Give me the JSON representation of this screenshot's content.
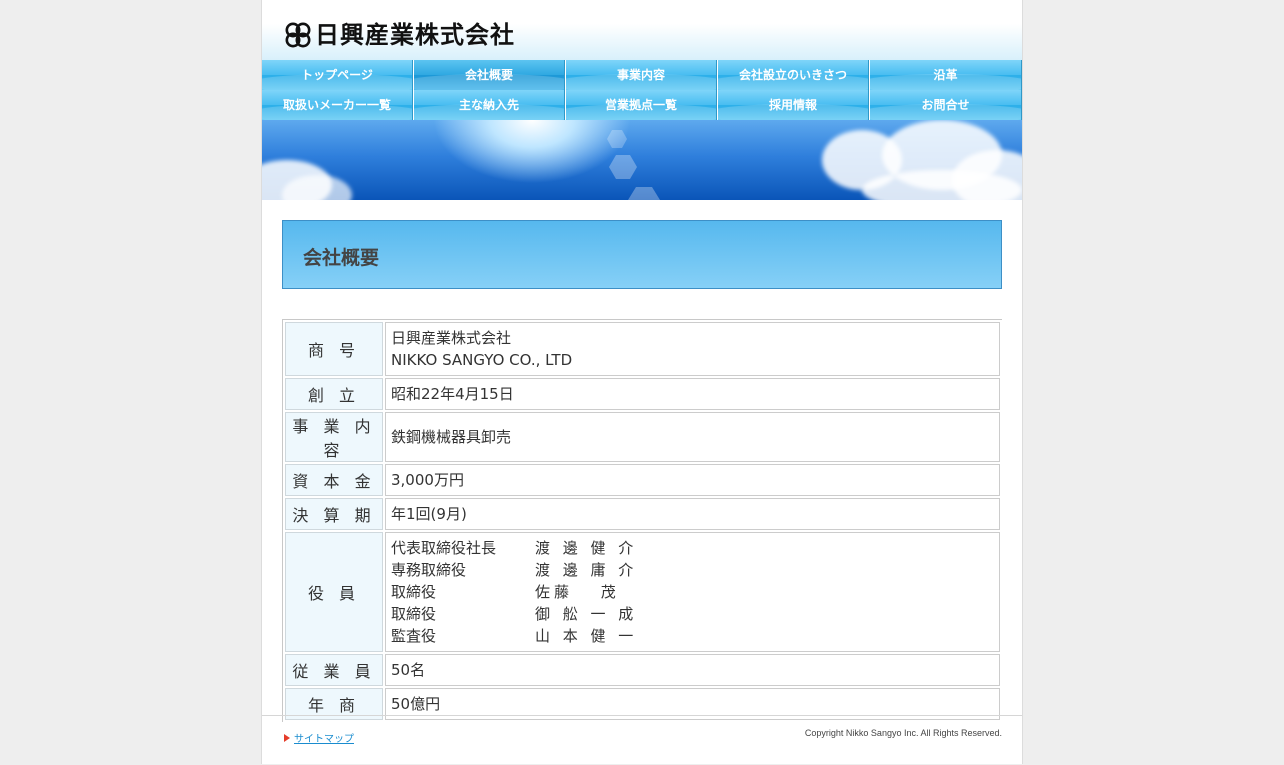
{
  "header": {
    "company_name": "日興産業株式会社",
    "logo_icon": "four-circle-knot-icon"
  },
  "nav": {
    "row1": [
      "トップページ",
      "会社概要",
      "事業内容",
      "会社設立のいきさつ",
      "沿革"
    ],
    "row2": [
      "取扱いメーカー一覧",
      "主な納入先",
      "営業拠点一覧",
      "採用情報",
      "お問合せ"
    ],
    "active": "会社概要",
    "colors": {
      "bar": "#48bdf1",
      "active": "#2ea8e2"
    }
  },
  "main": {
    "title": "会社概要",
    "profile": {
      "trade_name_label": "商 号",
      "trade_name_ja": "日興産業株式会社",
      "trade_name_en": "NIKKO SANGYO CO., LTD",
      "founded_label": "創 立",
      "founded": "昭和22年4月15日",
      "business_label": "事 業 内 容",
      "business": "鉄鋼機械器具卸売",
      "capital_label": "資 本 金",
      "capital": "3,000万円",
      "fiscal_label": "決 算 期",
      "fiscal": "年1回(9月)",
      "officers_label": "役 員",
      "officers": [
        {
          "role": "代表取締役社長",
          "name": "渡 邊 健 介"
        },
        {
          "role": "専務取締役",
          "name": "渡 邊 庸 介"
        },
        {
          "role": "取締役",
          "name": "佐藤　 茂"
        },
        {
          "role": "取締役",
          "name": "御 舩 一 成"
        },
        {
          "role": "監査役",
          "name": "山 本 健 一"
        }
      ],
      "employees_label": "従 業 員",
      "employees": "50名",
      "sales_label": "年 商",
      "sales": "50億円"
    }
  },
  "footer": {
    "sitemap": "サイトマップ",
    "copyright": "Copyright Nikko Sangyo Inc. All Rights Reserved."
  }
}
